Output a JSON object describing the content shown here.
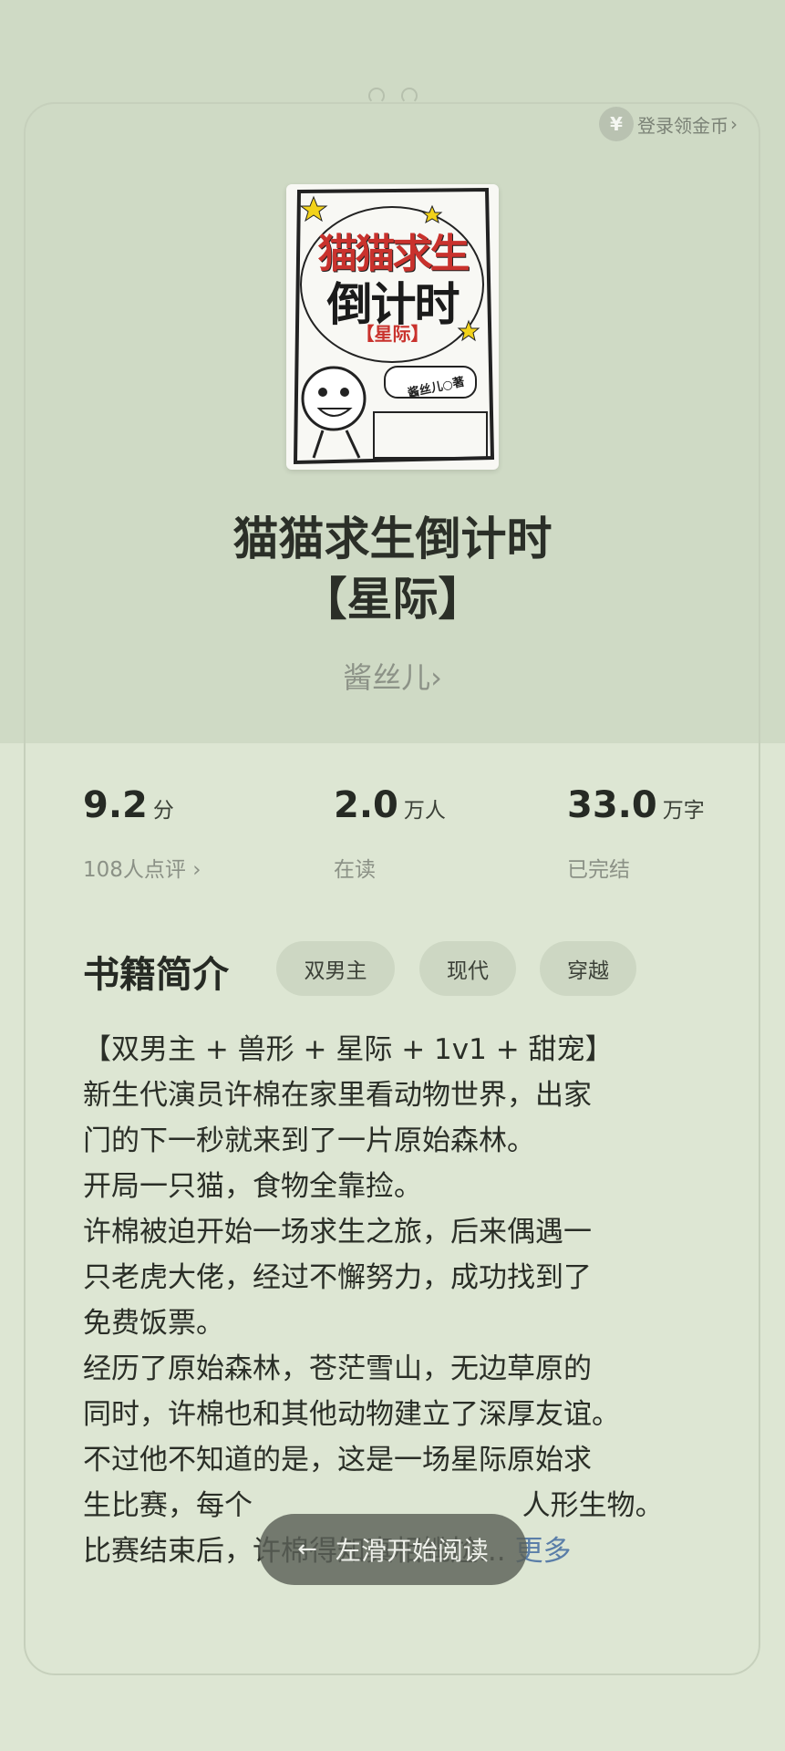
{
  "header": {
    "login_coin_label": "登录领金币",
    "coin_symbol": "¥",
    "chevron": "›"
  },
  "book": {
    "cover_title_line1": "猫猫求生",
    "cover_title_line2": "倒计时",
    "cover_tag": "【星际】",
    "cover_author": "酱丝儿○著",
    "title_line1": "猫猫求生倒计时",
    "title_line2": "【星际】",
    "author": "酱丝儿",
    "author_chevron": "›"
  },
  "stats": [
    {
      "value": "9.2",
      "unit": "分",
      "sub": "108人点评 ›"
    },
    {
      "value": "2.0",
      "unit": "万人",
      "sub": "在读"
    },
    {
      "value": "33.0",
      "unit": "万字",
      "sub": "已完结"
    }
  ],
  "intro": {
    "heading": "书籍简介",
    "tags": [
      "双男主",
      "现代",
      "穿越"
    ],
    "lines": [
      "【双男主 + 兽形 + 星际 + 1v1 + 甜宠】",
      "新生代演员许棉在家里看动物世界，出家",
      "门的下一秒就来到了一片原始森林。",
      "开局一只猫，食物全靠捡。",
      "许棉被迫开始一场求生之旅，后来偶遇一",
      "只老虎大佬，经过不懈努力，成功找到了",
      "免费饭票。",
      "经历了原始森林，苍茫雪山，无边草原的",
      "同时，许棉也和其他动物建立了深厚友谊。",
      "不过他不知道的是，这是一场星际原始求",
      "生比赛，每个                              人形生物。",
      "比赛结束后，许棉得知真相尴尬..."
    ],
    "more_label": "更多"
  },
  "reader": {
    "swipe_label": "左滑开始阅读",
    "arrow": "←"
  },
  "colors": {
    "background": "#d7e1cd",
    "link": "#5a7ea8",
    "pill": "#5c6058"
  }
}
